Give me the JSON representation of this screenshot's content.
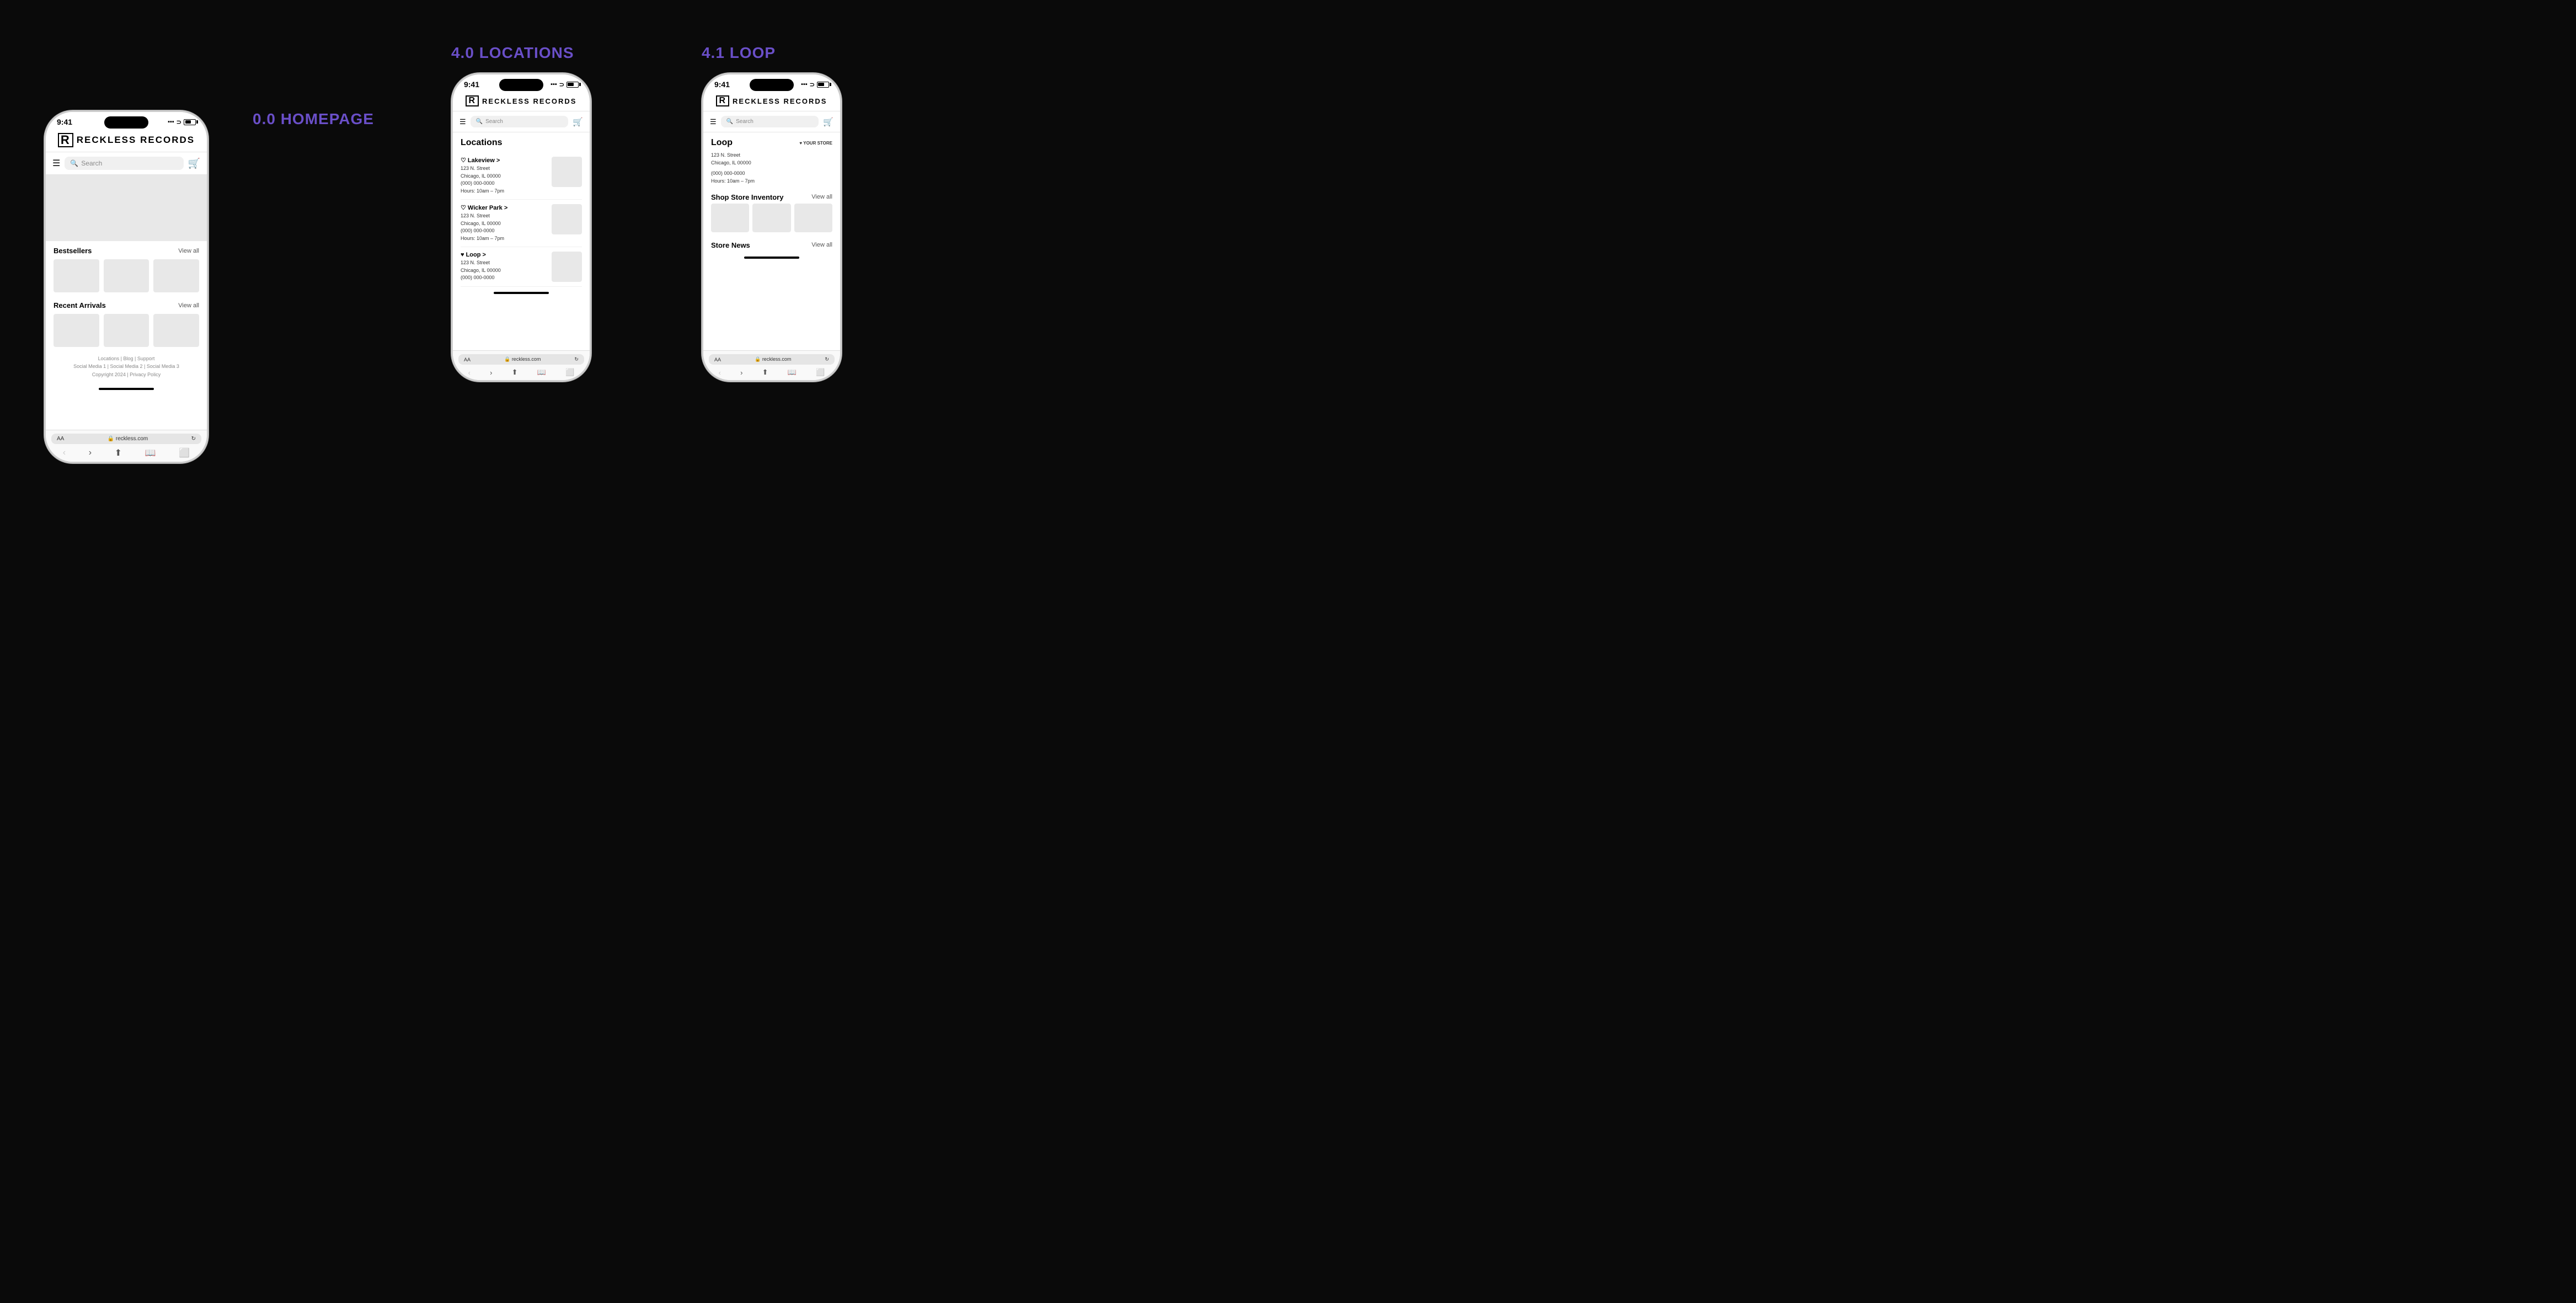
{
  "screens": {
    "homepage": {
      "label": "0.0 HOMEPAGE",
      "statusBar": {
        "time": "9:41",
        "url": "reckless.com"
      },
      "logo": "RECKLESS RECORDS",
      "nav": {
        "searchPlaceholder": "Search"
      },
      "sections": {
        "bestsellers": {
          "title": "Bestsellers",
          "viewAll": "View all"
        },
        "recentArrivals": {
          "title": "Recent Arrivals",
          "viewAll": "View all"
        }
      },
      "footer": {
        "links": "Locations | Blog | Support",
        "social": "Social Media 1 | Social Media 2 | Social Media 3",
        "copyright": "Copyright 2024 | Privacy Policy"
      }
    },
    "locations": {
      "label": "4.0 LOCATIONS",
      "statusBar": {
        "time": "9:41",
        "url": "reckless.com"
      },
      "logo": "RECKLESS RECORDS",
      "nav": {
        "searchPlaceholder": "Search"
      },
      "pageTitle": "Locations",
      "items": [
        {
          "name": "♡ Lakeview >",
          "address": "123 N. Street",
          "city": "Chicago, IL 00000",
          "phone": "(000) 000-0000",
          "hours": "Hours: 10am – 7pm"
        },
        {
          "name": "♡ Wicker Park >",
          "address": "123 N. Street",
          "city": "Chicago, IL 00000",
          "phone": "(000) 000-0000",
          "hours": "Hours: 10am – 7pm"
        },
        {
          "name": "♥ Loop >",
          "address": "123 N. Street",
          "city": "Chicago, IL 00000",
          "phone": "(000) 000-0000",
          "hours": ""
        }
      ]
    },
    "loop": {
      "label": "4.1 LOOP",
      "statusBar": {
        "time": "9:41",
        "url": "reckless.com"
      },
      "logo": "RECKLESS RECORDS",
      "nav": {
        "searchPlaceholder": "Search"
      },
      "pageTitle": "Loop",
      "yourStore": "♥ YOUR STORE",
      "address": "123 N. Street",
      "city": "Chicago, IL 00000",
      "phone": "(000) 000-0000",
      "hours": "Hours: 10am – 7pm",
      "shopStoreInventory": "Shop Store Inventory",
      "viewAll": "View all",
      "storeNews": "Store News",
      "storeNewsViewAll": "View all"
    }
  },
  "colors": {
    "accent": "#6a4fc8",
    "background": "#0a0a0a",
    "phoneBackground": "#ffffff",
    "grayThumb": "#e8e8e8",
    "searchBg": "#f0f0f0"
  }
}
